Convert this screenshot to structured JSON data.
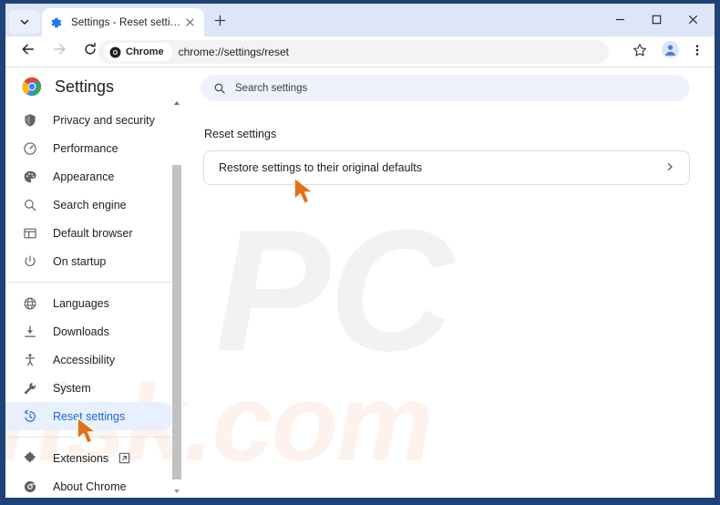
{
  "window": {
    "minimize_label": "minimize-icon",
    "maximize_label": "maximize-icon",
    "close_label": "close-icon"
  },
  "tabstrip": {
    "tab_search_icon": "chevron-down-icon",
    "new_tab_icon": "plus-icon",
    "tabs": [
      {
        "favicon": "settings-gear-icon",
        "title": "Settings - Reset settings",
        "close_icon": "close-icon"
      }
    ]
  },
  "toolbar": {
    "back_icon": "arrow-back-icon",
    "forward_icon": "arrow-forward-icon",
    "reload_icon": "reload-icon",
    "chip_icon": "chrome-logo-icon",
    "chip_label": "Chrome",
    "url": "chrome://settings/reset",
    "bookmark_icon": "star-icon",
    "profile_icon": "person-avatar-icon",
    "menu_icon": "three-dot-menu-icon"
  },
  "sidebar": {
    "logo": "chrome-logo-icon",
    "title": "Settings",
    "scroll_up_icon": "scroll-up-arrow",
    "scroll_down_icon": "scroll-down-arrow",
    "items": [
      {
        "icon": "shield-icon",
        "label": "Privacy and security",
        "active": false
      },
      {
        "icon": "performance-icon",
        "label": "Performance",
        "active": false
      },
      {
        "icon": "palette-icon",
        "label": "Appearance",
        "active": false
      },
      {
        "icon": "search-icon",
        "label": "Search engine",
        "active": false
      },
      {
        "icon": "browser-window-icon",
        "label": "Default browser",
        "active": false
      },
      {
        "icon": "power-icon",
        "label": "On startup",
        "active": false
      }
    ],
    "items2": [
      {
        "icon": "globe-icon",
        "label": "Languages",
        "active": false
      },
      {
        "icon": "download-icon",
        "label": "Downloads",
        "active": false
      },
      {
        "icon": "accessibility-icon",
        "label": "Accessibility",
        "active": false
      },
      {
        "icon": "wrench-icon",
        "label": "System",
        "active": false
      },
      {
        "icon": "reset-clock-icon",
        "label": "Reset settings",
        "active": true
      }
    ],
    "items3": [
      {
        "icon": "puzzle-icon",
        "label": "Extensions",
        "external": true,
        "external_icon": "open-in-new-icon"
      },
      {
        "icon": "chrome-ring-icon",
        "label": "About Chrome",
        "external": false,
        "external_icon": ""
      }
    ]
  },
  "main": {
    "search": {
      "icon": "search-icon",
      "placeholder": "Search settings",
      "value": ""
    },
    "section_title": "Reset settings",
    "rows": [
      {
        "label": "Restore settings to their original defaults",
        "arrow": "chevron-right-icon"
      }
    ]
  },
  "watermark": {
    "line1": "PC",
    "line2": "risk.com"
  },
  "colors": {
    "accent": "#1967d2",
    "active_bg": "#e8f0fe",
    "frame": "#1f4379",
    "tabstrip": "#dce6f8",
    "cursor": "#e1701a"
  }
}
